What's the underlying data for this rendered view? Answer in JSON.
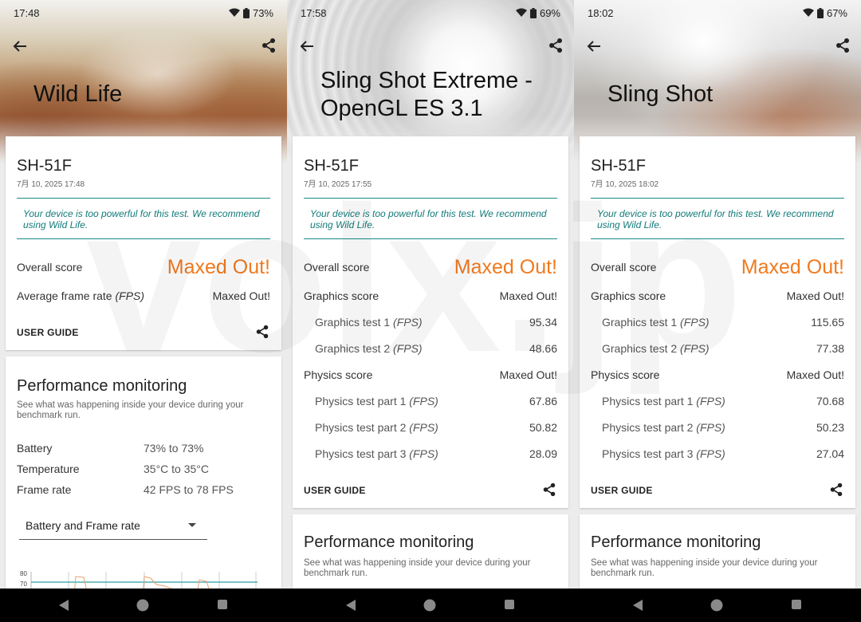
{
  "colors": {
    "accent_orange": "#f07a1f",
    "notice_teal": "#127a7a",
    "chart_line": "#e8a070"
  },
  "icons": {
    "back": "arrow-left-icon",
    "share": "share-icon",
    "wifi": "wifi-icon",
    "battery": "battery-icon",
    "nav_back": "nav-back-icon",
    "nav_home": "nav-home-icon",
    "nav_recents": "nav-recents-icon"
  },
  "screens": [
    {
      "status": {
        "time": "17:48",
        "battery": "73%"
      },
      "title": "Wild Life",
      "device": "SH-51F",
      "date": "7月 10, 2025 17:48",
      "notice": "Your device is too powerful for this test. We recommend using Wild Life.",
      "overall": {
        "label": "Overall score",
        "value": "Maxed Out!"
      },
      "rows": [
        {
          "label": "Average frame rate",
          "unit": "(FPS)",
          "value": "Maxed Out!",
          "sub": false
        }
      ],
      "guide": "USER GUIDE",
      "perf": {
        "title": "Performance monitoring",
        "desc": "See what was happening inside your device during your benchmark run.",
        "metrics": [
          {
            "label": "Battery",
            "value": "73% to 73%"
          },
          {
            "label": "Temperature",
            "value": "35°C to 35°C"
          },
          {
            "label": "Frame rate",
            "value": "42 FPS to 78 FPS"
          }
        ],
        "dropdown": "Battery and Frame rate",
        "chart": {
          "y_ticks": [
            "80",
            "70"
          ]
        }
      }
    },
    {
      "status": {
        "time": "17:58",
        "battery": "69%"
      },
      "title": "Sling Shot Extreme - OpenGL ES 3.1",
      "device": "SH-51F",
      "date": "7月 10, 2025 17:55",
      "notice": "Your device is too powerful for this test. We recommend using Wild Life.",
      "overall": {
        "label": "Overall score",
        "value": "Maxed Out!"
      },
      "rows": [
        {
          "label": "Graphics score",
          "unit": "",
          "value": "Maxed Out!",
          "sub": false
        },
        {
          "label": "Graphics test 1",
          "unit": "(FPS)",
          "value": "95.34",
          "sub": true
        },
        {
          "label": "Graphics test 2",
          "unit": "(FPS)",
          "value": "48.66",
          "sub": true
        },
        {
          "label": "Physics score",
          "unit": "",
          "value": "Maxed Out!",
          "sub": false
        },
        {
          "label": "Physics test part 1",
          "unit": "(FPS)",
          "value": "67.86",
          "sub": true
        },
        {
          "label": "Physics test part 2",
          "unit": "(FPS)",
          "value": "50.82",
          "sub": true
        },
        {
          "label": "Physics test part 3",
          "unit": "(FPS)",
          "value": "28.09",
          "sub": true
        }
      ],
      "guide": "USER GUIDE",
      "perf": {
        "title": "Performance monitoring",
        "desc": "See what was happening inside your device during your benchmark run."
      }
    },
    {
      "status": {
        "time": "18:02",
        "battery": "67%"
      },
      "title": "Sling Shot",
      "device": "SH-51F",
      "date": "7月 10, 2025 18:02",
      "notice": "Your device is too powerful for this test. We recommend using Wild Life.",
      "overall": {
        "label": "Overall score",
        "value": "Maxed Out!"
      },
      "rows": [
        {
          "label": "Graphics score",
          "unit": "",
          "value": "Maxed Out!",
          "sub": false
        },
        {
          "label": "Graphics test 1",
          "unit": "(FPS)",
          "value": "115.65",
          "sub": true
        },
        {
          "label": "Graphics test 2",
          "unit": "(FPS)",
          "value": "77.38",
          "sub": true
        },
        {
          "label": "Physics score",
          "unit": "",
          "value": "Maxed Out!",
          "sub": false
        },
        {
          "label": "Physics test part 1",
          "unit": "(FPS)",
          "value": "70.68",
          "sub": true
        },
        {
          "label": "Physics test part 2",
          "unit": "(FPS)",
          "value": "50.23",
          "sub": true
        },
        {
          "label": "Physics test part 3",
          "unit": "(FPS)",
          "value": "27.04",
          "sub": true
        }
      ],
      "guide": "USER GUIDE",
      "perf": {
        "title": "Performance monitoring",
        "desc": "See what was happening inside your device during your benchmark run."
      }
    }
  ],
  "watermark": "volx.jp"
}
